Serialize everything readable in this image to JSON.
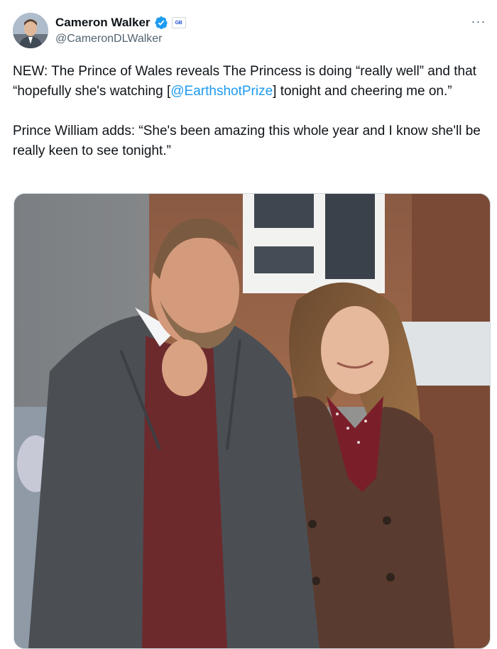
{
  "author": {
    "display_name": "Cameron Walker",
    "handle": "@CameronDLWalker",
    "verified": true,
    "affiliate_badge": "GB NEWS"
  },
  "tweet": {
    "para1_lead": "NEW: The Prince of Wales reveals The Princess is doing “really well” and that “hopefully she's watching [",
    "mention": "@EarthshotPrize",
    "para1_tail": "] tonight and cheering me on.”",
    "para2": "Prince William adds: “She's been amazing this whole year and I know she'll be really keen to see tonight.”"
  },
  "menu": {
    "more_glyph": "···"
  },
  "media": {
    "alt": "Prince William and the Princess of Wales walking outdoors"
  },
  "colors": {
    "link": "#1d9bf0",
    "verified": "#1d9bf0",
    "text": "#0f1419",
    "secondary": "#536471"
  }
}
